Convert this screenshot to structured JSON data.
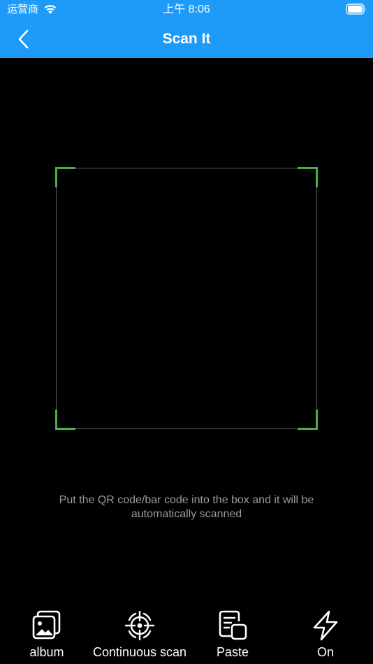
{
  "status_bar": {
    "carrier": "运营商",
    "time": "上午 8:06"
  },
  "nav": {
    "title": "Scan It"
  },
  "scanner": {
    "hint": "Put the QR code/bar code into the box and it will be automatically scanned"
  },
  "toolbar": {
    "album_label": "album",
    "continuous_label": "Continuous scan",
    "paste_label": "Paste",
    "flash_label": "On"
  },
  "colors": {
    "header": "#1E9BF8",
    "corner_accent": "#4CAF3F",
    "background": "#000000"
  },
  "icons": {
    "back": "chevron-left-icon",
    "album": "album-icon",
    "continuous": "crosshair-icon",
    "paste": "paste-icon",
    "flash": "flash-icon"
  }
}
